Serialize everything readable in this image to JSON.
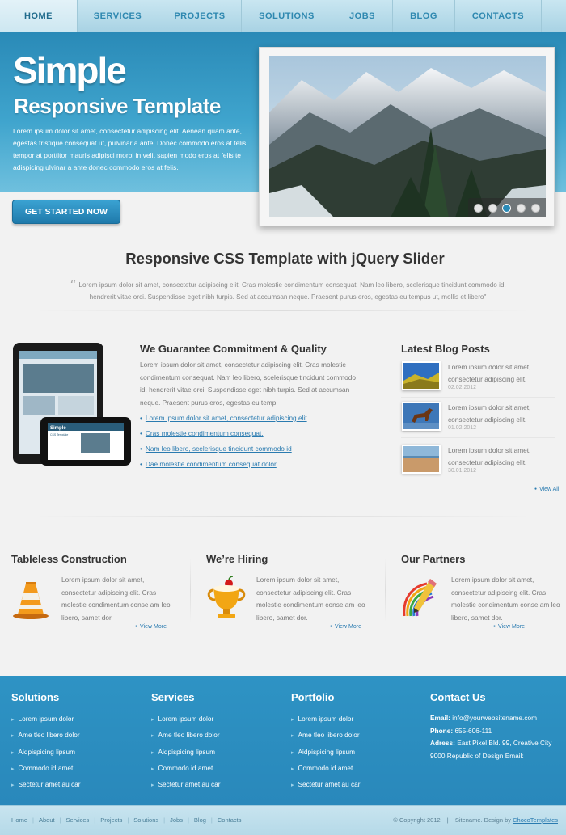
{
  "nav": {
    "items": [
      {
        "label": "HOME",
        "active": true
      },
      {
        "label": "SERVICES",
        "active": false
      },
      {
        "label": "PROJECTS",
        "active": false
      },
      {
        "label": "SOLUTIONS",
        "active": false
      },
      {
        "label": "JOBS",
        "active": false
      },
      {
        "label": "BLOG",
        "active": false
      },
      {
        "label": "CONTACTS",
        "active": false
      }
    ]
  },
  "hero": {
    "title": "Simple",
    "subtitle": "Responsive Template",
    "text": "Lorem ipsum dolor sit amet, consectetur adipiscing elit. Aenean quam ante, egestas tristique consequat ut, pulvinar a ante. Donec commodo eros at felis tempor at porttitor mauris adipisci morbi in velit sapien modo eros at felis te adispicing ulvinar a ante donec commodo eros at felis.",
    "cta_label": "GET STARTED NOW",
    "slider_dot_count": 5,
    "slider_active_dot": 3
  },
  "intro": {
    "title": "Responsive CSS Template with jQuery Slider",
    "quote": "Lorem ipsum dolor sit amet, consectetur adipiscing elit. Cras molestie condimentum consequat. Nam leo libero, scelerisque tincidunt commodo id, hendrerit vitae orci. Suspendisse eget nibh turpis. Sed at accumsan neque. Praesent purus eros, egestas eu tempus ut, mollis et libero\""
  },
  "guarantee": {
    "title": "We Guarantee Commitment & Quality",
    "text": "Lorem ipsum dolor sit amet, consectetur adipiscing elit. Cras molestie condimentum consequat. Nam leo libero, scelerisque tincidunt commodo id, hendrerit vitae orci. Suspendisse eget nibh turpis. Sed at accumsan neque. Praesent purus eros, egestas eu temp",
    "links": [
      "Lorem ipsum dolor sit amet, consectetur adipiscing elit",
      "Cras molestie condimentum consequat.",
      "Nam leo libero, scelerisque tincidunt commodo id",
      "Dae molestie condimentum consequat dolor"
    ],
    "device_screen_title": "Simple",
    "device_screen_subtitle": "CSS Template"
  },
  "blog": {
    "title": "Latest Blog Posts",
    "posts": [
      {
        "text": "Lorem ipsum dolor sit amet, consectetur adipiscing elit.",
        "date": "02.02.2012",
        "thumb": "hills"
      },
      {
        "text": "Lorem ipsum dolor sit amet, consectetur adipiscing elit.",
        "date": "01.02.2012",
        "thumb": "horse"
      },
      {
        "text": "Lorem ipsum dolor sit amet, consectetur adipiscing elit.",
        "date": "30.01.2012",
        "thumb": "beach"
      }
    ],
    "view_all": "View All"
  },
  "features": [
    {
      "title": "Tableless Construction",
      "text": "Lorem ipsum dolor sit amet, consectetur adipiscing elit. Cras molestie condimentum conse am leo libero, samet dor.",
      "link": "View More",
      "icon": "traffic-cone-icon"
    },
    {
      "title": "We’re Hiring",
      "text": "Lorem ipsum dolor sit amet, consectetur adipiscing elit. Cras molestie condimentum conse am leo libero, samet dor.",
      "link": "View More",
      "icon": "trophy-icon"
    },
    {
      "title": "Our Partners",
      "text": "Lorem ipsum dolor sit amet, consectetur adipiscing elit. Cras molestie condimentum conse am leo libero, samet dor.",
      "link": "View More",
      "icon": "pencil-arc-icon"
    }
  ],
  "footer": {
    "columns": [
      {
        "title": "Solutions",
        "items": [
          "Lorem ipsum dolor",
          "Ame tleo libero dolor",
          "Aidpispicing lipsum",
          "Commodo id amet",
          "Sectetur amet au car"
        ]
      },
      {
        "title": "Services",
        "items": [
          "Lorem ipsum dolor",
          "Ame tleo libero dolor",
          "Aidpispicing lipsum",
          "Commodo id amet",
          "Sectetur amet au car"
        ]
      },
      {
        "title": "Portfolio",
        "items": [
          "Lorem ipsum dolor",
          "Ame tleo libero dolor",
          "Aidpispicing lipsum",
          "Commodo id amet",
          "Sectetur amet au car"
        ]
      }
    ],
    "contact": {
      "title": "Contact Us",
      "email_label": "Email:",
      "email": "info@yourwebsitename.com",
      "phone_label": "Phone:",
      "phone": "655-606-111",
      "address_label": "Adress:",
      "address": "East Pixel Bld. 99, Creative City 9000,Republic of Design Email:"
    }
  },
  "bottom": {
    "links": [
      "Home",
      "About",
      "Services",
      "Projects",
      "Solutions",
      "Jobs",
      "Blog",
      "Contacts"
    ],
    "copyright": "© Copyright 2012",
    "sitename": "Sitename. Design by",
    "brand": "ChocoTemplates"
  },
  "colors": {
    "accent": "#2a8ab7",
    "nav_bg": "#b9dcea",
    "footer_bg": "#2e93c4",
    "link": "#2a7bb0"
  }
}
